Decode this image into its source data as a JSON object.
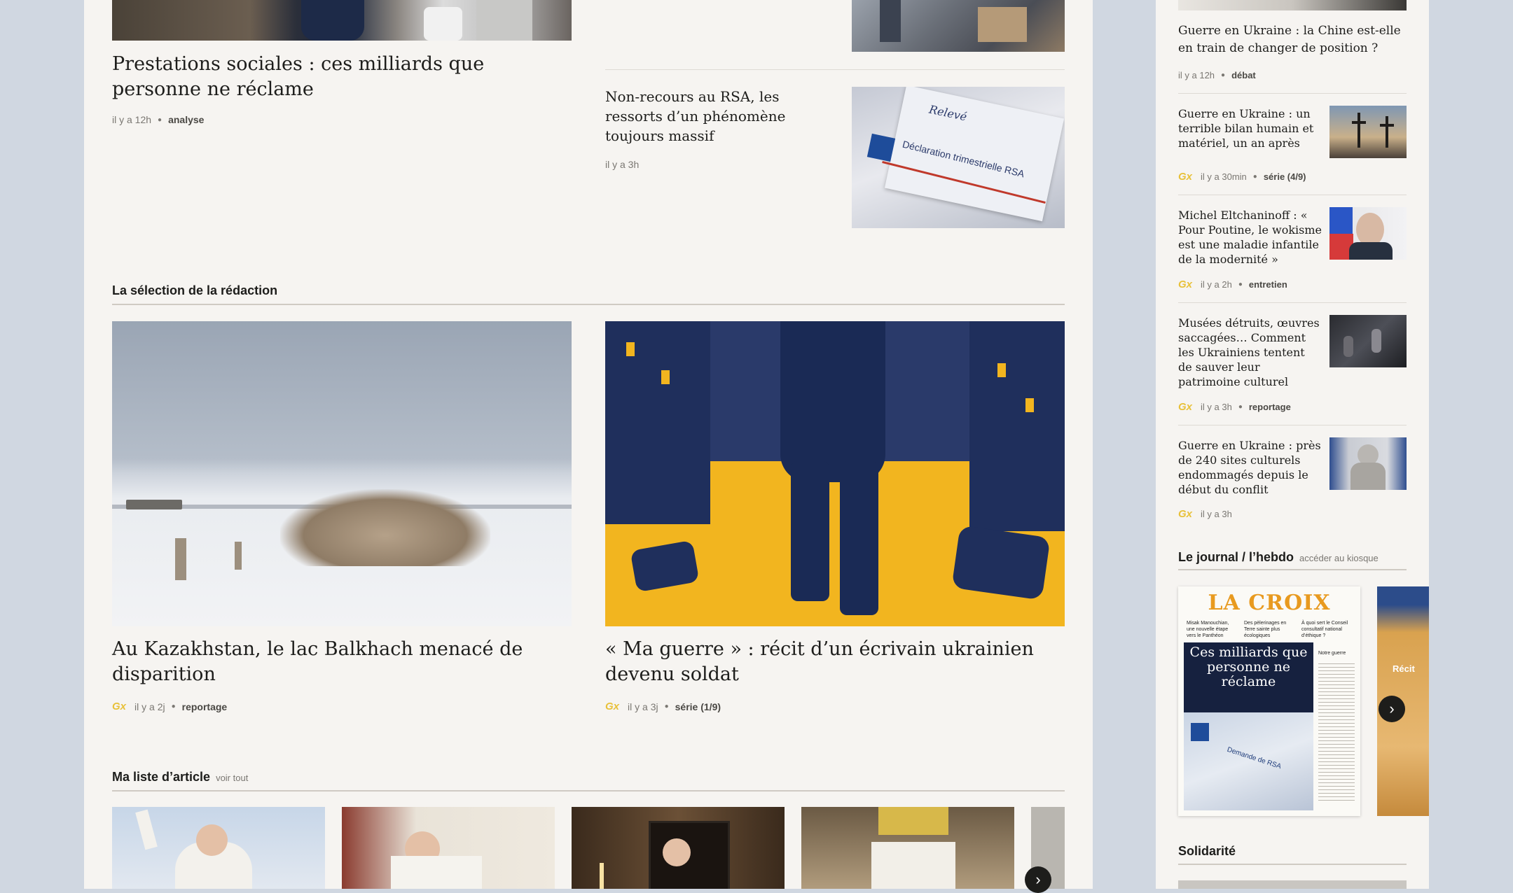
{
  "top": {
    "lead": {
      "title": "Prestations sociales : ces milliards que personne ne réclame",
      "time": "il y a 12h",
      "tag": "analyse"
    },
    "side": {
      "title": "Non-recours au RSA, les ressorts d’un phénomène toujours massif",
      "time": "il y a 3h",
      "image_text_1": "Relevé",
      "image_text_2": "Déclaration trimestrielle RSA"
    }
  },
  "selection": {
    "heading": "La sélection de la rédaction",
    "articles": [
      {
        "title": "Au Kazakhstan, le lac Balkhach menacé de disparition",
        "badge": "Gx",
        "time": "il y a 2j",
        "tag": "reportage"
      },
      {
        "title": "« Ma guerre » : récit d’un écrivain ukrainien devenu soldat",
        "badge": "Gx",
        "time": "il y a 3j",
        "tag": "série (1/9)"
      }
    ]
  },
  "my_list": {
    "heading": "Ma liste d’article",
    "see_all": "voir tout",
    "next_icon": "chevron-right-icon"
  },
  "sidebar": {
    "top_item": {
      "title": "Guerre en Ukraine : la Chine est-elle en train de changer de position ?",
      "time": "il y a 12h",
      "tag": "débat"
    },
    "items": [
      {
        "title": "Guerre en Ukraine : un terrible bilan humain et matériel, un an après",
        "badge": "Gx",
        "time": "il y a 30min",
        "tag": "série (4/9)"
      },
      {
        "title": "Michel Eltchaninoff : « Pour Poutine, le wokisme est une maladie infantile de la modernité »",
        "badge": "Gx",
        "time": "il y a 2h",
        "tag": "entretien"
      },
      {
        "title": "Musées détruits, œuvres saccagées… Comment les Ukrainiens tentent de sauver leur patrimoine culturel",
        "badge": "Gx",
        "time": "il y a 3h",
        "tag": "reportage"
      },
      {
        "title": "Guerre en Ukraine : près de 240 sites culturels endommagés depuis le début du conflit",
        "badge": "Gx",
        "time": "il y a 3h",
        "tag": ""
      }
    ],
    "journal": {
      "heading": "Le journal / l’hebdo",
      "link": "accéder au kiosque",
      "cover": {
        "masthead": "LA CROIX",
        "headline": "Ces milliards que personne ne réclame",
        "sub1": "Misak Manouchian, une nouvelle étape vers le Panthéon",
        "sub2": "Des pèlerinages en Terre sainte plus écologiques",
        "sub3": "À quoi sert le Conseil consultatif national d’éthique ?",
        "sub4": "Notre guerre",
        "doc": "Demande de RSA"
      },
      "cover2_text": "Récit",
      "next_icon": "chevron-right-icon"
    },
    "solidarite": "Solidarité"
  },
  "colors": {
    "background": "#d0d7e1",
    "panel": "#f6f4f1",
    "accent_gold": "#e8c13a",
    "yellow_illustration": "#f2b51f",
    "navy": "#1f2f5c"
  }
}
